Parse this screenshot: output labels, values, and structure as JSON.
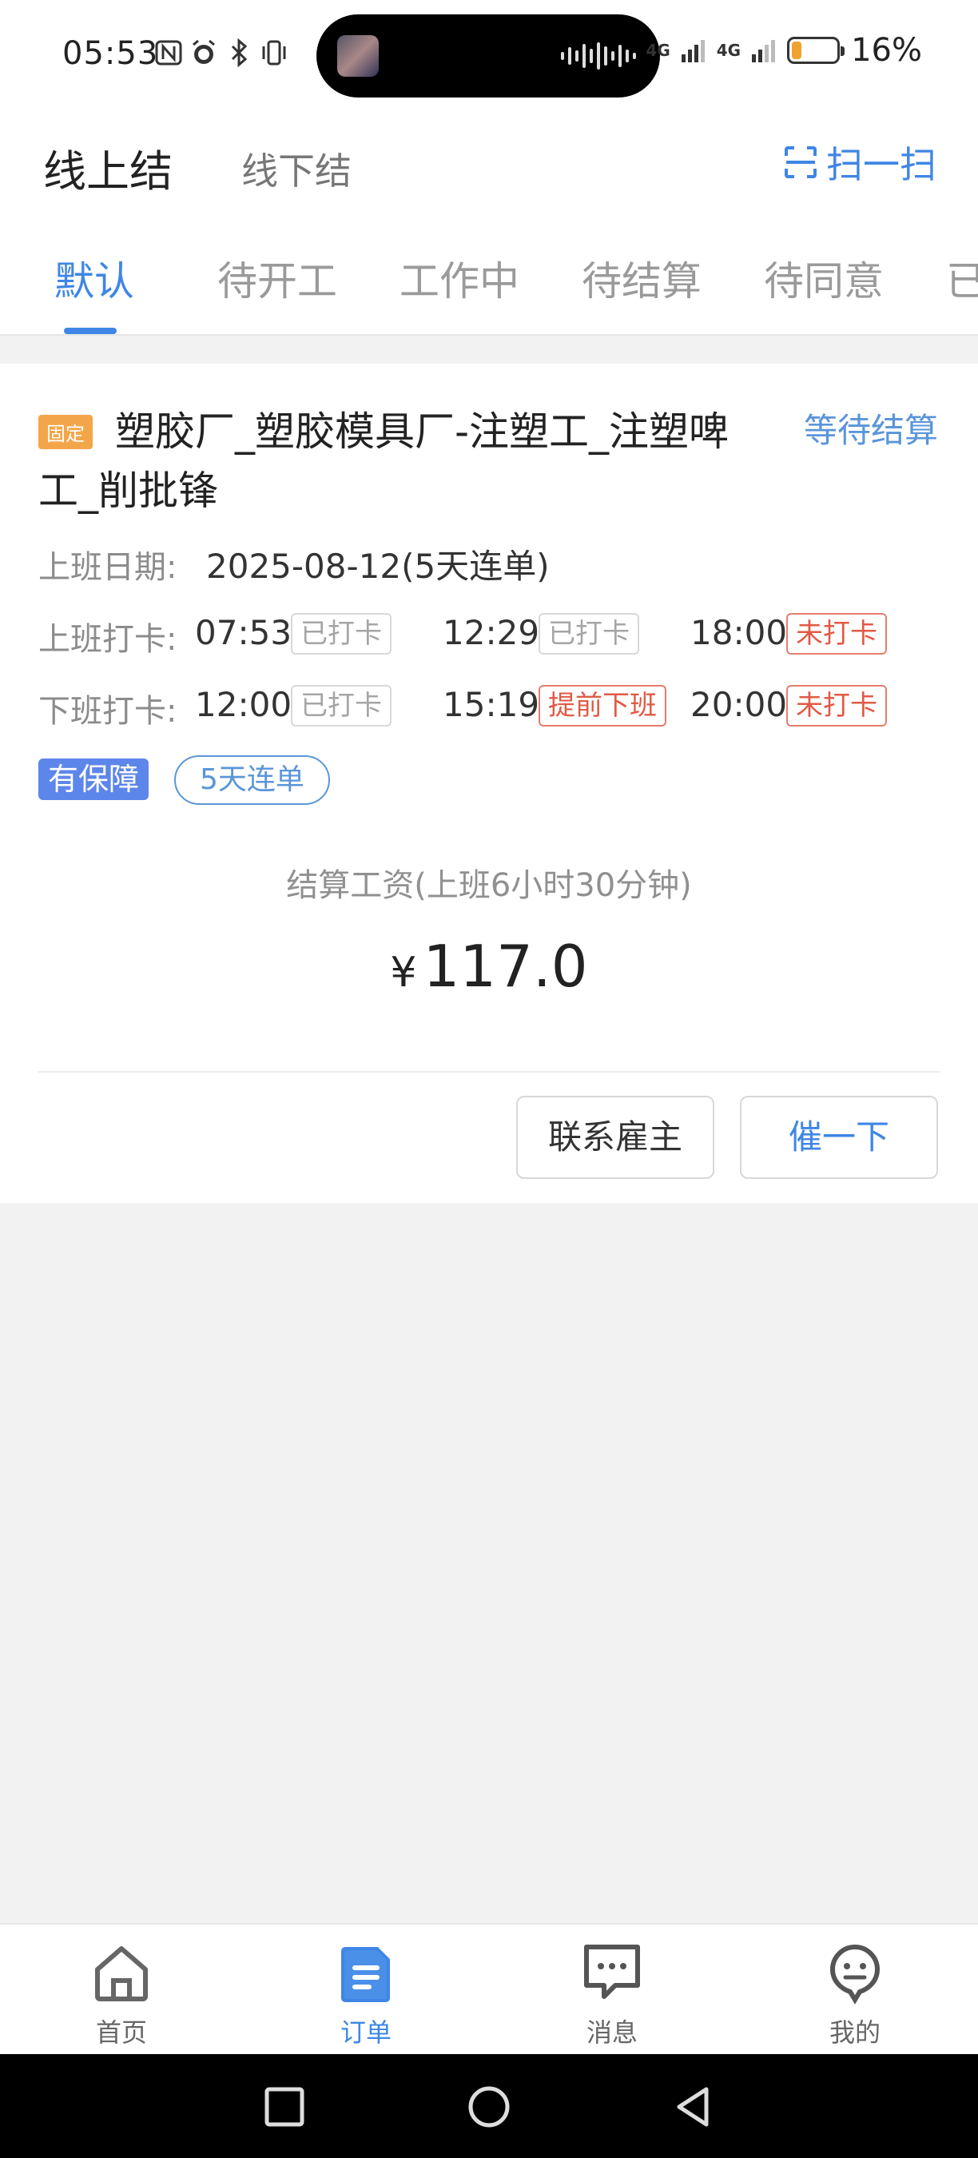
{
  "status_bar": {
    "time": "05:53",
    "network_1": "4G",
    "network_2": "4G",
    "battery_percent": "16%",
    "battery_level": 0.16
  },
  "header": {
    "tab_online": "线上结",
    "tab_offline": "线下结",
    "scan_label": "扫一扫"
  },
  "sub_tabs": [
    "默认",
    "待开工",
    "工作中",
    "待结算",
    "待同意",
    "已"
  ],
  "order": {
    "badge": "固定",
    "title": "塑胶厂_塑胶模具厂-注塑工_注塑啤工_削批锋",
    "status": "等待结算",
    "date_label": "上班日期:",
    "date_value": "2025-08-12(5天连单)",
    "clock_in_label": "上班打卡:",
    "clock_in": [
      {
        "time": "07:53",
        "state": "已打卡"
      },
      {
        "time": "12:29",
        "state": "已打卡"
      },
      {
        "time": "18:00",
        "state": "未打卡"
      }
    ],
    "clock_out_label": "下班打卡:",
    "clock_out": [
      {
        "time": "12:00",
        "state": "已打卡"
      },
      {
        "time": "15:19",
        "state": "提前下班"
      },
      {
        "time": "20:00",
        "state": "未打卡"
      }
    ],
    "tag_guarantee": "有保障",
    "tag_streak": "5天连单",
    "wage_label": "结算工资(上班6小时30分钟)",
    "currency": "¥",
    "wage_amount": "117.0",
    "btn_contact": "联系雇主",
    "btn_urge": "催一下"
  },
  "bottom_nav": [
    {
      "label": "首页",
      "icon": "home-icon"
    },
    {
      "label": "订单",
      "icon": "order-icon"
    },
    {
      "label": "消息",
      "icon": "message-icon"
    },
    {
      "label": "我的",
      "icon": "profile-icon"
    }
  ],
  "colors": {
    "accent": "#3f86e6",
    "warning": "#e05a45",
    "badge_orange": "#f3a649",
    "guarantee": "#5d86ea"
  }
}
